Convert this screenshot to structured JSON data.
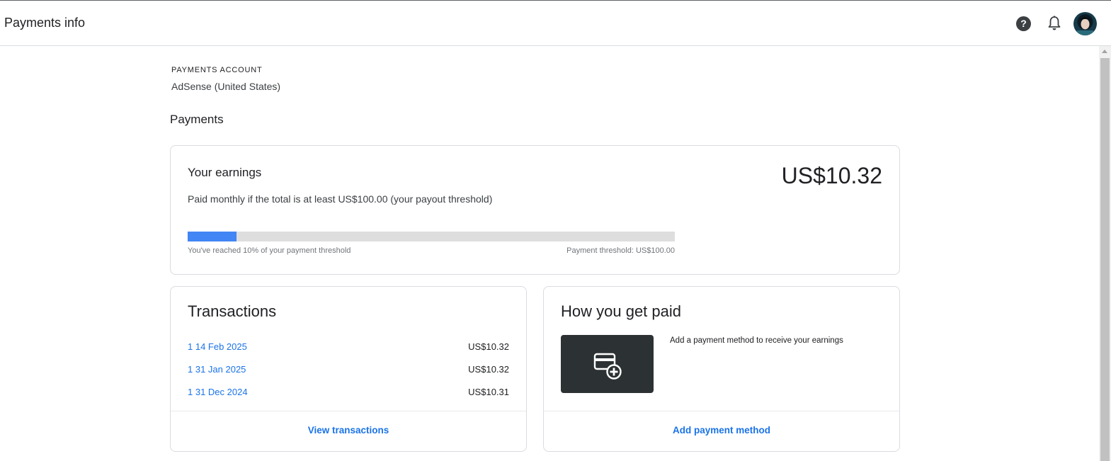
{
  "header": {
    "title": "Payments info",
    "help_icon": "help-circle-icon",
    "notifications_icon": "bell-icon",
    "avatar_icon": "user-avatar"
  },
  "account": {
    "label": "PAYMENTS ACCOUNT",
    "value": "AdSense (United States)"
  },
  "payments": {
    "section_title": "Payments",
    "earnings": {
      "heading": "Your earnings",
      "amount": "US$10.32",
      "subtext": "Paid monthly if the total is at least US$100.00 (your payout threshold)",
      "progress_fraction": 0.1,
      "progress_label": "You've reached 10% of your payment threshold",
      "threshold_label": "Payment threshold: US$100.00"
    },
    "transactions": {
      "title": "Transactions",
      "rows": [
        {
          "date": "1  14 Feb 2025",
          "amount": "US$10.32"
        },
        {
          "date": "1  31 Jan 2025",
          "amount": "US$10.32"
        },
        {
          "date": "1  31 Dec 2024",
          "amount": "US$10.31"
        }
      ],
      "action": "View transactions"
    },
    "how_paid": {
      "title": "How you get paid",
      "description": "Add a payment method to receive your earnings",
      "icon": "add-card-icon",
      "action": "Add payment method"
    }
  },
  "colors": {
    "accent": "#1a73e8",
    "progress_fill": "#4285f4",
    "progress_track": "#dedede"
  }
}
